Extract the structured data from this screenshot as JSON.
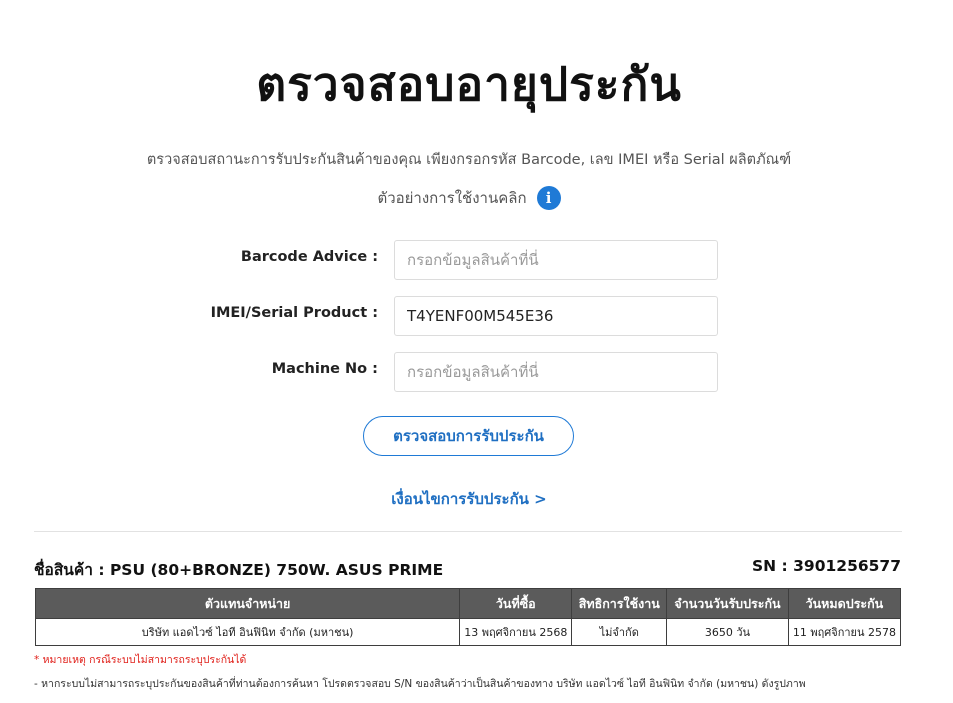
{
  "header": {
    "title": "ตรวจสอบอายุประกัน",
    "subtitle": "ตรวจสอบสถานะการรับประกันสินค้าของคุณ เพียงกรอกรหัส Barcode, เลข IMEI หรือ Serial ผลิตภัณฑ์",
    "example_text": "ตัวอย่างการใช้งานคลิก",
    "info_icon_glyph": "i"
  },
  "form": {
    "barcode": {
      "label": "Barcode Advice :",
      "value": "",
      "placeholder": "กรอกข้อมูลสินค้าที่นี่"
    },
    "imei": {
      "label": "IMEI/Serial Product :",
      "value": "T4YENF00M545E36",
      "placeholder": "กรอกข้อมูลสินค้าที่นี่"
    },
    "machine": {
      "label": "Machine No :",
      "value": "",
      "placeholder": "กรอกข้อมูลสินค้าที่นี่"
    },
    "submit_label": "ตรวจสอบการรับประกัน",
    "conditions_link": "เงื่อนไขการรับประกัน >"
  },
  "result": {
    "product_name": "ชื่อสินค้า : PSU (80+BRONZE) 750W. ASUS PRIME",
    "serial_number": "SN : 3901256577",
    "table": {
      "headers": [
        "ตัวแทนจำหน่าย",
        "วันที่ซื้อ",
        "สิทธิการใช้งาน",
        "จำนวนวันรับประกัน",
        "วันหมดประกัน"
      ],
      "rows": [
        [
          "บริษัท แอดไวซ์ ไอที อินฟินิท จำกัด (มหาชน)",
          "13 พฤศจิกายน 2568",
          "ไม่จำกัด",
          "3650 วัน",
          "11 พฤศจิกายน 2578"
        ]
      ]
    },
    "note_red": "* หมายเหตุ กรณีระบบไม่สามารถระบุประกันได้",
    "note_text": "- หากระบบไม่สามารถระบุประกันของสินค้าที่ท่านต้องการค้นหา โปรดตรวจสอบ S/N ของสินค้าว่าเป็นสินค้าของทาง บริษัท แอดไวซ์ ไอที อินฟินิท จำกัด (มหาชน) ดังรูปภาพ"
  },
  "colors": {
    "accent": "#1f7ad6",
    "link": "#1f6fc2",
    "table_header": "#5b5b5b",
    "note_red": "#e0201a"
  }
}
